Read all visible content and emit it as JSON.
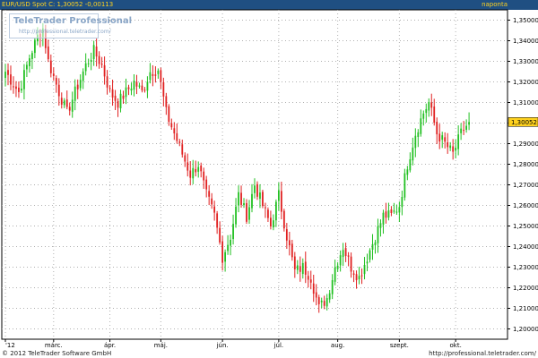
{
  "header": {
    "title": "EUR/USD Spot C: 1,30052 -0,00113",
    "period": "naponta"
  },
  "watermark": {
    "name": "TeleTrader Professional",
    "url": "http://professional.teletrader.com/"
  },
  "footer": {
    "copyright": "© 2012 TeleTrader Software GmbH",
    "url": "http://professional.teletrader.com/"
  },
  "colors": {
    "header_bg": "#1f4f82",
    "header_text": "#ffd21f",
    "up_candle": "#22c022",
    "down_candle": "#e02020",
    "grid": "#b0b0b0",
    "last_price_bg": "#ffd21f"
  },
  "chart_data": {
    "type": "candlestick",
    "instrument": "EUR/USD Spot",
    "last_price_label": "1,30052",
    "ylim": [
      1.195,
      1.355
    ],
    "y_ticks": [
      "1,35000",
      "1,34000",
      "1,33000",
      "1,32000",
      "1,31000",
      "1,30000",
      "1,29000",
      "1,28000",
      "1,27000",
      "1,26000",
      "1,25000",
      "1,24000",
      "1,23000",
      "1,22000",
      "1,21000",
      "1,20000"
    ],
    "x_ticks": [
      {
        "label": "'12",
        "index": 0
      },
      {
        "label": "márc.",
        "index": 18
      },
      {
        "label": "ápr.",
        "index": 39
      },
      {
        "label": "máj.",
        "index": 58
      },
      {
        "label": "jún.",
        "index": 81
      },
      {
        "label": "júl.",
        "index": 102
      },
      {
        "label": "aug.",
        "index": 124
      },
      {
        "label": "szept.",
        "index": 147
      },
      {
        "label": "okt.",
        "index": 168
      }
    ],
    "n_slots": 182,
    "close_waypoints": [
      [
        0,
        1.325
      ],
      [
        5,
        1.315
      ],
      [
        9,
        1.332
      ],
      [
        12,
        1.342
      ],
      [
        14,
        1.346
      ],
      [
        16,
        1.33
      ],
      [
        20,
        1.315
      ],
      [
        23,
        1.305
      ],
      [
        26,
        1.315
      ],
      [
        30,
        1.328
      ],
      [
        33,
        1.335
      ],
      [
        36,
        1.328
      ],
      [
        39,
        1.315
      ],
      [
        42,
        1.31
      ],
      [
        45,
        1.315
      ],
      [
        48,
        1.32
      ],
      [
        51,
        1.315
      ],
      [
        54,
        1.325
      ],
      [
        57,
        1.326
      ],
      [
        60,
        1.305
      ],
      [
        63,
        1.295
      ],
      [
        66,
        1.285
      ],
      [
        69,
        1.275
      ],
      [
        72,
        1.28
      ],
      [
        75,
        1.265
      ],
      [
        78,
        1.255
      ],
      [
        81,
        1.235
      ],
      [
        84,
        1.245
      ],
      [
        87,
        1.265
      ],
      [
        90,
        1.255
      ],
      [
        93,
        1.27
      ],
      [
        96,
        1.26
      ],
      [
        99,
        1.25
      ],
      [
        102,
        1.265
      ],
      [
        105,
        1.245
      ],
      [
        108,
        1.228
      ],
      [
        111,
        1.23
      ],
      [
        114,
        1.225
      ],
      [
        117,
        1.21
      ],
      [
        120,
        1.215
      ],
      [
        123,
        1.23
      ],
      [
        126,
        1.24
      ],
      [
        129,
        1.23
      ],
      [
        132,
        1.225
      ],
      [
        135,
        1.235
      ],
      [
        138,
        1.245
      ],
      [
        141,
        1.255
      ],
      [
        144,
        1.255
      ],
      [
        147,
        1.26
      ],
      [
        150,
        1.28
      ],
      [
        153,
        1.295
      ],
      [
        156,
        1.305
      ],
      [
        158,
        1.31
      ],
      [
        161,
        1.295
      ],
      [
        164,
        1.29
      ],
      [
        167,
        1.285
      ],
      [
        170,
        1.295
      ],
      [
        173,
        1.3005
      ]
    ]
  }
}
